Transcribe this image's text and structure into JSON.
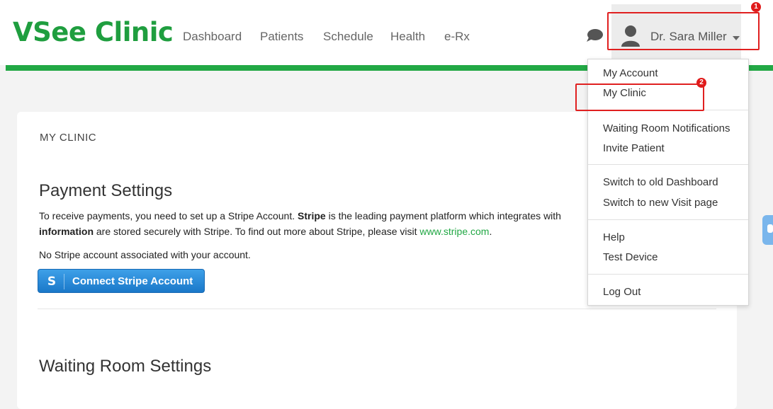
{
  "header": {
    "logo": "VSee Clinic",
    "nav": [
      "Dashboard",
      "Patients",
      "Schedule",
      "Health",
      "e-Rx"
    ],
    "user_name": "Dr. Sara Miller"
  },
  "annotations": {
    "badge_1": "1",
    "badge_2": "2"
  },
  "main": {
    "section_label": "MY CLINIC",
    "payment": {
      "title": "Payment Settings",
      "line1_start": "To receive payments, you need to set up a Stripe Account. ",
      "line1_bold": "Stripe",
      "line1_end": " is the leading payment platform which integrates with",
      "line2_bold": "information",
      "line2_mid": " are stored securely with Stripe. To find out more about Stripe, please visit ",
      "line2_link": "www.stripe.com",
      "line2_end": ".",
      "no_account": "No Stripe account associated with your account.",
      "button_icon": "S",
      "button_label": "Connect Stripe Account"
    },
    "waiting": {
      "title": "Waiting Room Settings"
    }
  },
  "dropdown": {
    "items": [
      "My Account",
      "My Clinic",
      "Waiting Room Notifications",
      "Invite Patient",
      "Switch to old Dashboard",
      "Switch to new Visit page",
      "Help",
      "Test Device",
      "Log Out"
    ]
  },
  "colors": {
    "brand_green": "#22a845",
    "annotation_red": "#e02020",
    "button_blue": "#1a78c9"
  },
  "icons": {
    "chat": "chat-bubble-icon",
    "avatar": "user-avatar-icon",
    "dropdown": "caret-down-icon",
    "side_tab": "feedback-tab-icon"
  }
}
